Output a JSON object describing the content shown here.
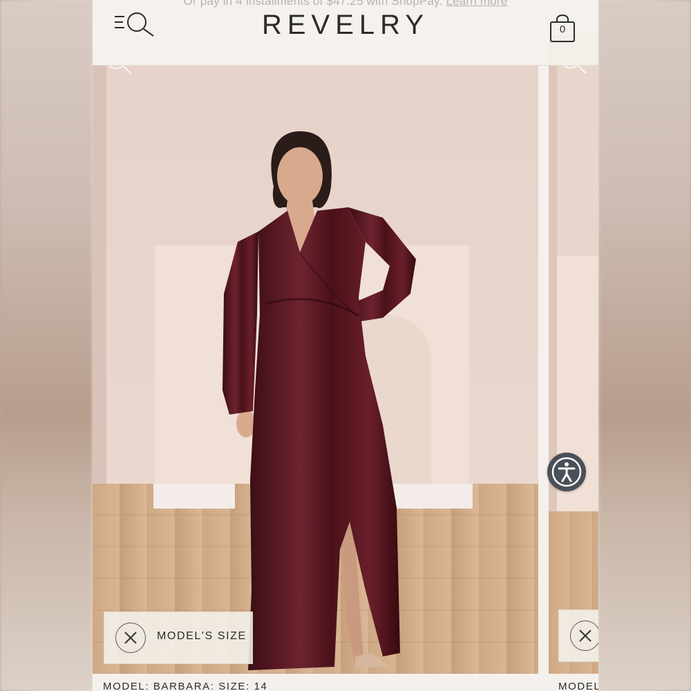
{
  "promo": {
    "text": "Or pay in 4 installments of $47.25 with ShopPay.",
    "link": "Learn more"
  },
  "header": {
    "logo": "REVELRY",
    "cart_count": "0",
    "menu_icon": "menu-search-icon",
    "cart_icon": "shopping-bag-icon"
  },
  "gallery": {
    "slides": [
      {
        "badge_label": "MODEL'S SIZE",
        "caption": "MODEL: BARBARA: SIZE: 14"
      },
      {
        "caption": "MODEL"
      }
    ]
  },
  "accessibility": {
    "icon": "accessibility-icon"
  },
  "colors": {
    "background": "#f4f1ec",
    "dress": "#5c1a24",
    "accessibility_button": "#4a5057"
  }
}
